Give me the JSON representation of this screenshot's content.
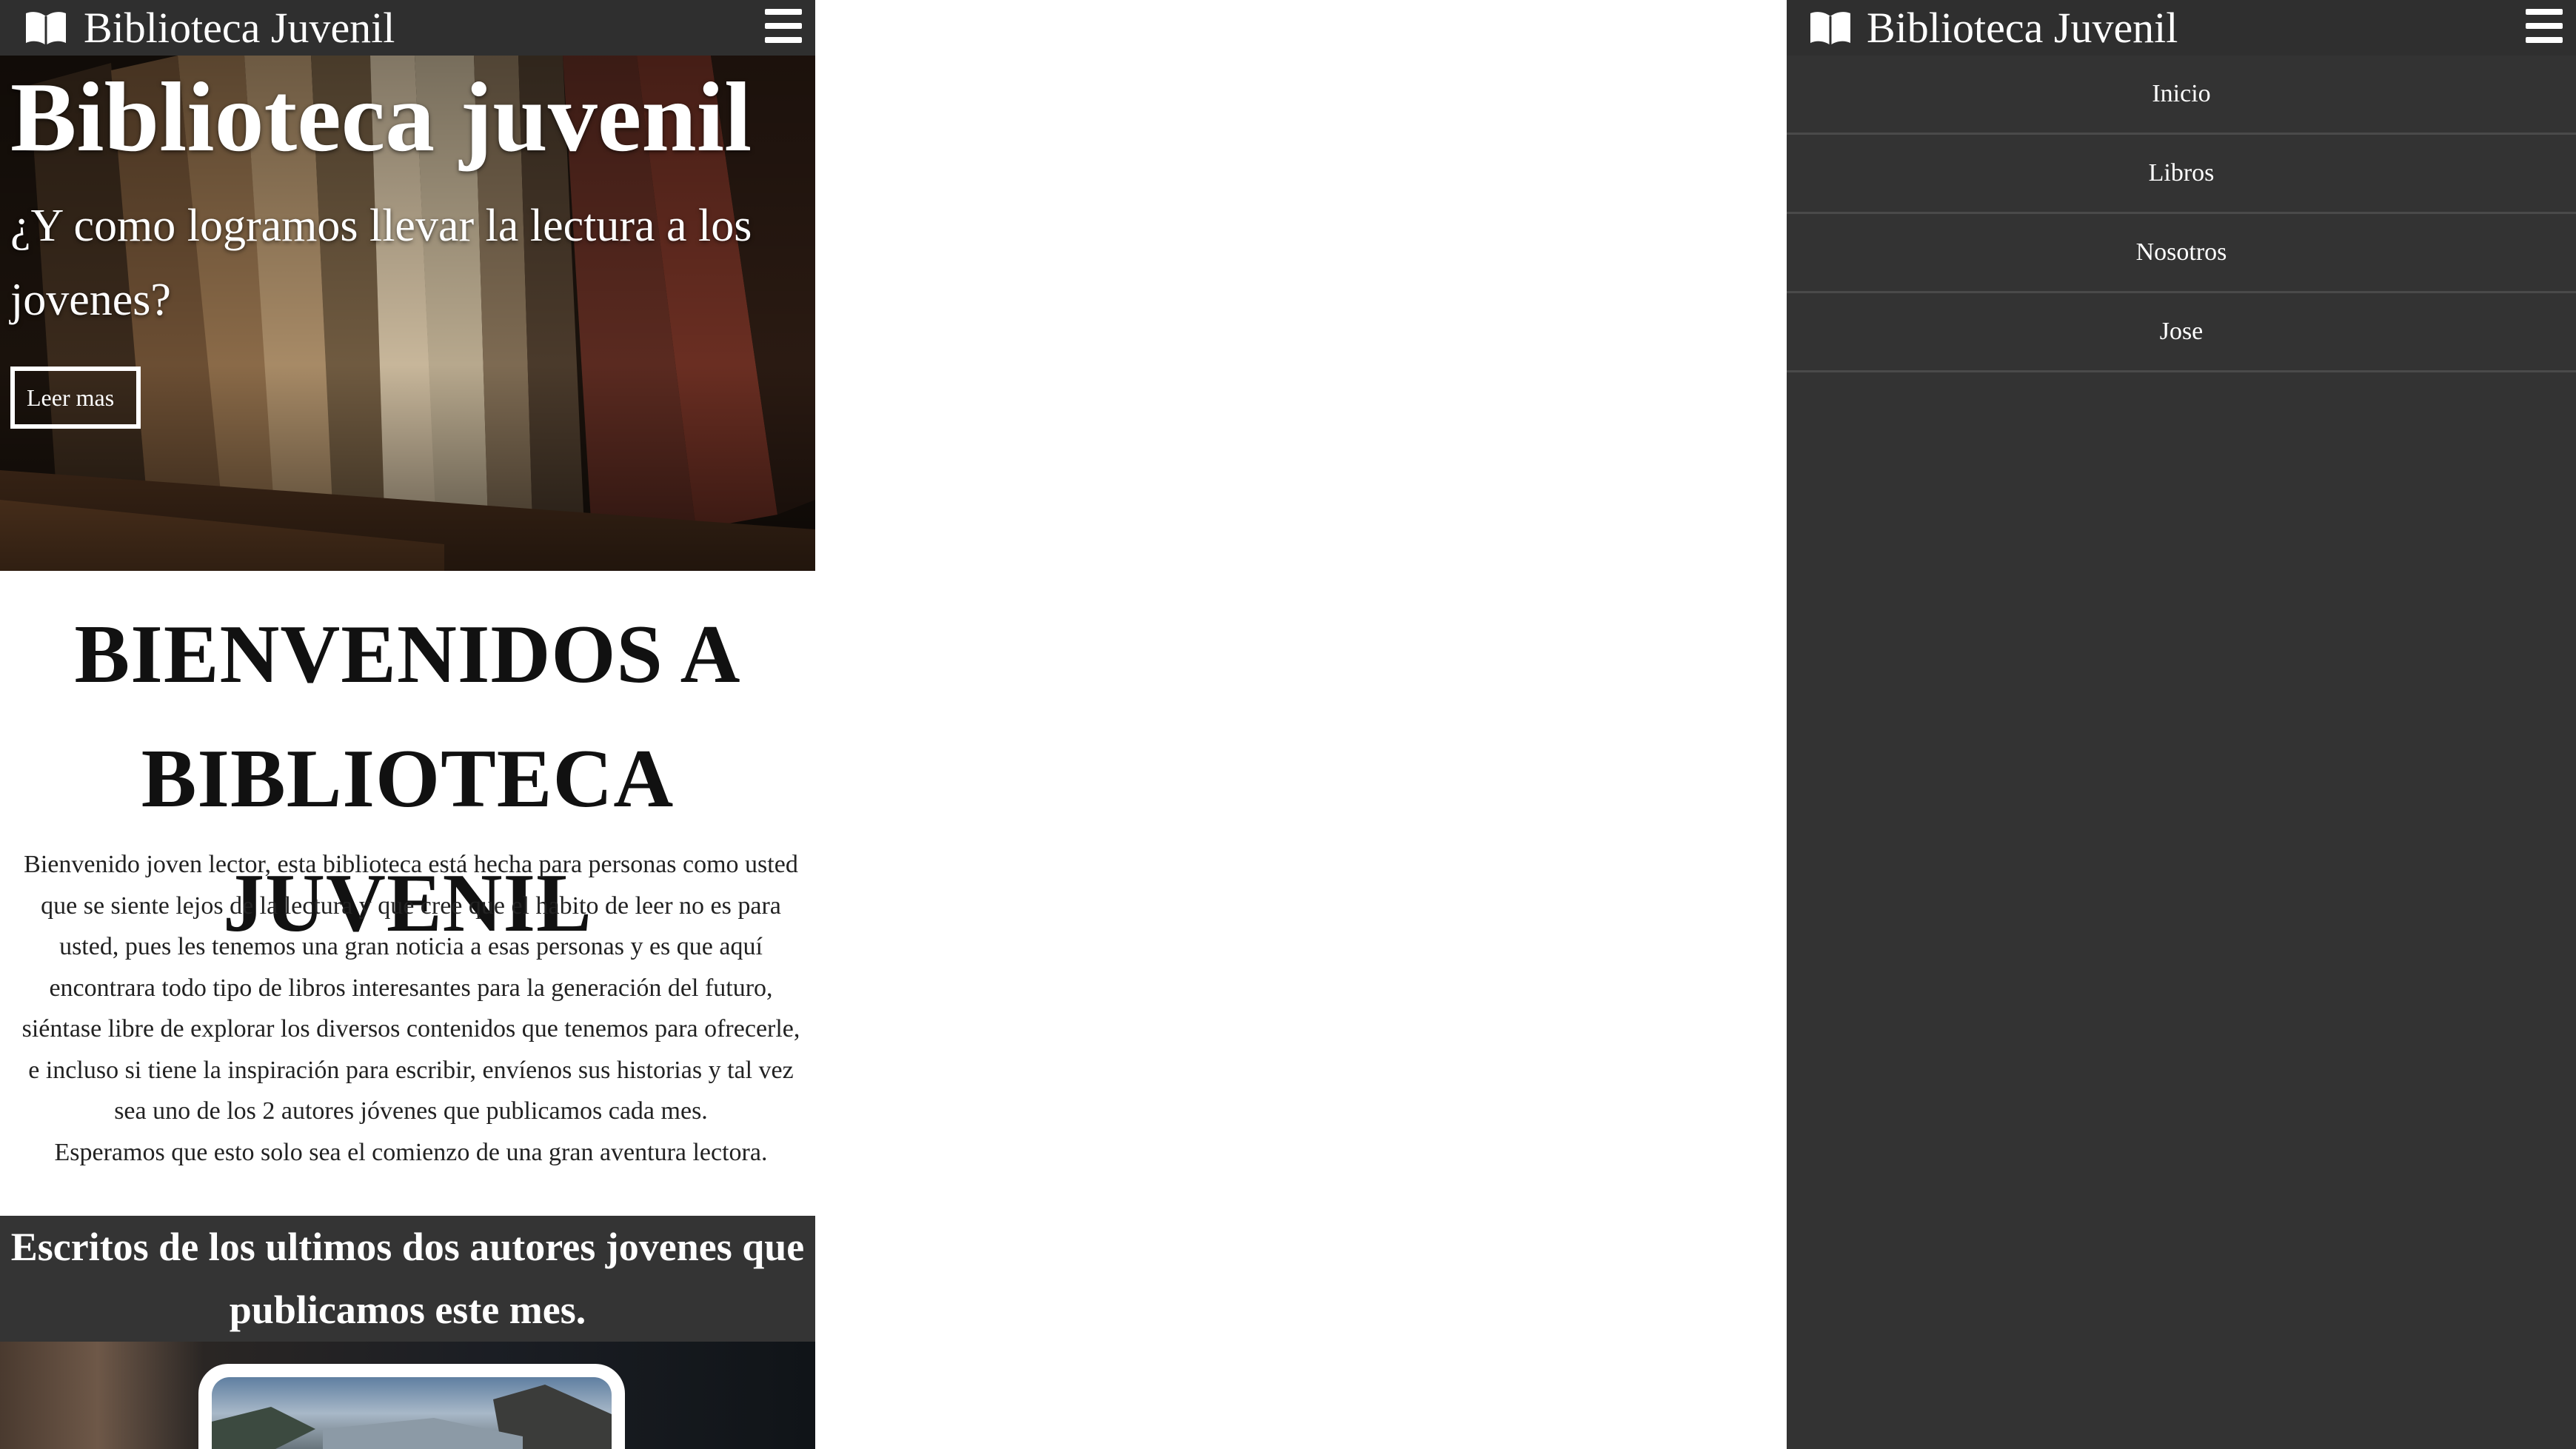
{
  "brand": {
    "name": "Biblioteca Juvenil",
    "icon": "open-book-icon"
  },
  "nav": {
    "menu_icon": "hamburger-icon"
  },
  "hero": {
    "title": "Biblioteca juvenil",
    "subtitle": "¿Y como logramos llevar la lectura a los jovenes?",
    "button_label": "Leer mas"
  },
  "welcome": {
    "title": "BIENVENIDOS A BIBLIOTECA JUVENIL",
    "paragraph": "Bienvenido joven lector, esta biblioteca está hecha para personas como usted que se siente lejos de la lectura y que cree que el habito de leer no es para usted, pues les tenemos una gran noticia a esas personas y es que aquí encontrara todo tipo de libros interesantes para la generación del futuro, siéntase libre de explorar los diversos contenidos que tenemos para ofrecerle, e incluso si tiene la inspiración para escribir, envíenos sus historias y tal vez sea uno de los 2 autores jóvenes que publicamos cada mes.",
    "closing": "Esperamos que esto solo sea el comienzo de una gran aventura lectora."
  },
  "authors_section": {
    "title": "Escritos de los ultimos dos autores jovenes que publicamos este mes."
  },
  "menu": {
    "items": [
      {
        "label": "Inicio"
      },
      {
        "label": "Libros"
      },
      {
        "label": "Nosotros"
      },
      {
        "label": "Jose"
      }
    ]
  },
  "colors": {
    "navbar_bg": "#2f2f2f",
    "menu_bg": "#333333",
    "band_bg": "#343434",
    "text_light": "#ffffff",
    "text_dark": "#111111"
  }
}
